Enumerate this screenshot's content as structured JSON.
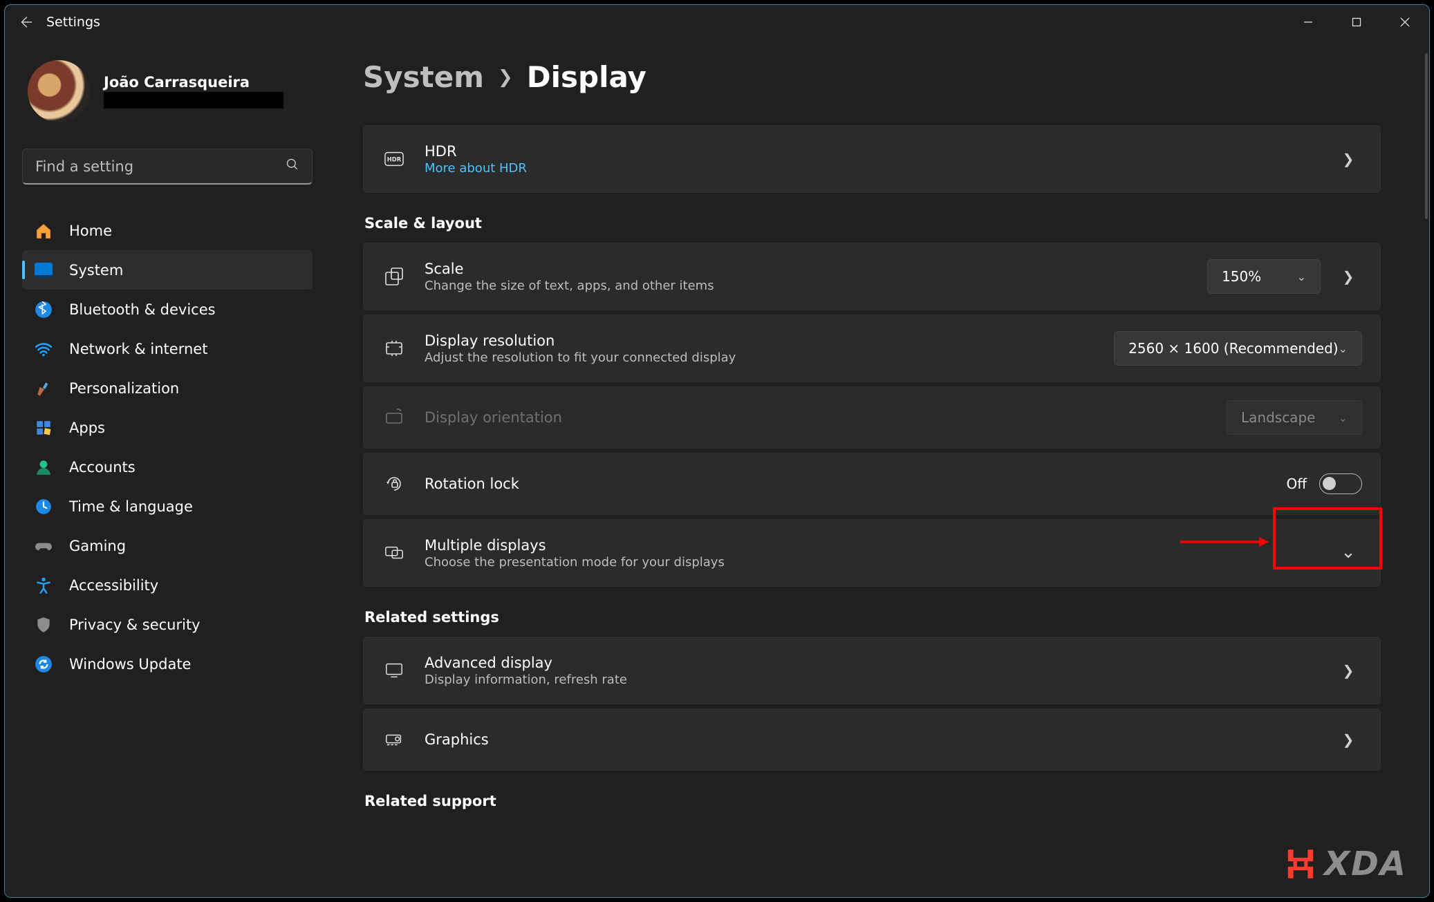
{
  "window": {
    "title": "Settings"
  },
  "user": {
    "name": "João Carrasqueira"
  },
  "search": {
    "placeholder": "Find a setting"
  },
  "nav": {
    "home": "Home",
    "system": "System",
    "bluetooth": "Bluetooth & devices",
    "network": "Network & internet",
    "personalization": "Personalization",
    "apps": "Apps",
    "accounts": "Accounts",
    "time": "Time & language",
    "gaming": "Gaming",
    "accessibility": "Accessibility",
    "privacy": "Privacy & security",
    "update": "Windows Update"
  },
  "breadcrumb": {
    "parent": "System",
    "current": "Display"
  },
  "cards": {
    "hdr": {
      "title": "HDR",
      "link": "More about HDR"
    },
    "section_scale": "Scale & layout",
    "scale": {
      "title": "Scale",
      "sub": "Change the size of text, apps, and other items",
      "value": "150%"
    },
    "resolution": {
      "title": "Display resolution",
      "sub": "Adjust the resolution to fit your connected display",
      "value": "2560 × 1600 (Recommended)"
    },
    "orientation": {
      "title": "Display orientation",
      "value": "Landscape"
    },
    "rotation": {
      "title": "Rotation lock",
      "toggle_label": "Off"
    },
    "multi": {
      "title": "Multiple displays",
      "sub": "Choose the presentation mode for your displays"
    },
    "section_related": "Related settings",
    "advanced": {
      "title": "Advanced display",
      "sub": "Display information, refresh rate"
    },
    "graphics": {
      "title": "Graphics"
    },
    "section_support": "Related support"
  },
  "brand": "XDA"
}
